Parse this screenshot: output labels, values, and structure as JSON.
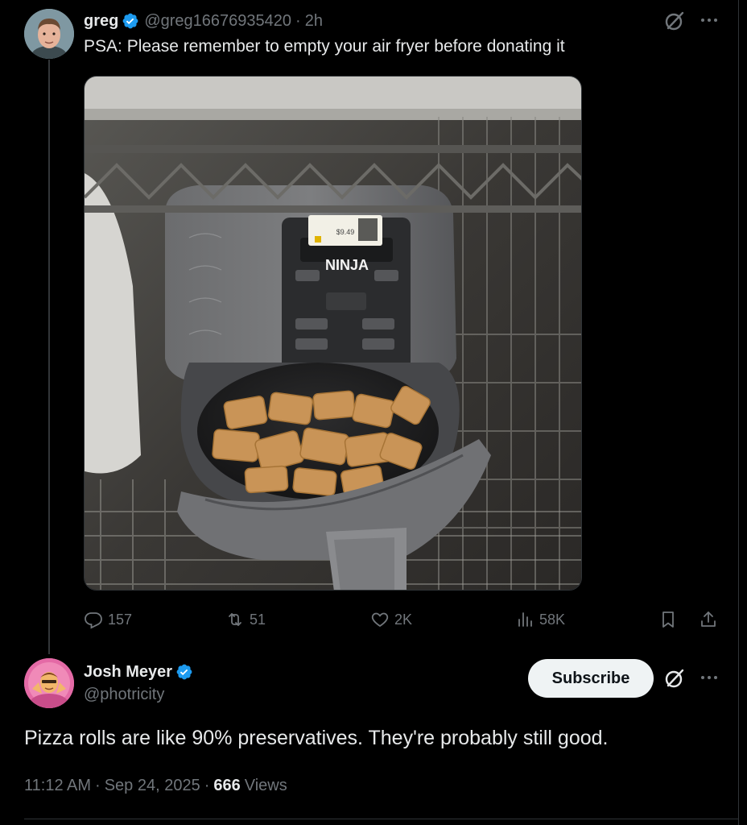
{
  "parent_tweet": {
    "author": {
      "name": "greg",
      "handle": "@greg16676935420",
      "verified": true,
      "avatar": "avatar-photo-greg"
    },
    "time": "2h",
    "text": "PSA: Please remember to empty your air fryer before donating it",
    "media": {
      "description_icon": "photo",
      "brand_label": "NINJA",
      "price_tag": "$9.49"
    },
    "stats": {
      "replies": "157",
      "retweets": "51",
      "likes": "2K",
      "views": "58K"
    }
  },
  "main_tweet": {
    "author": {
      "name": "Josh Meyer",
      "handle": "@photricity",
      "verified": true,
      "avatar": "avatar-photo-josh"
    },
    "subscribe_label": "Subscribe",
    "text": "Pizza rolls are like 90% preservatives. They're probably still good.",
    "timestamp": "11:12 AM",
    "date": "Sep 24, 2025",
    "views_count": "666",
    "views_label": "Views"
  },
  "colors": {
    "background": "#000000",
    "text_primary": "#e7e9ea",
    "text_secondary": "#71767b",
    "verified_blue": "#1d9bf0",
    "divider": "#2f3336"
  },
  "icons": {
    "reply": "reply-bubble-icon",
    "retweet": "retweet-icon",
    "like": "heart-icon",
    "views": "views-bars-icon",
    "bookmark": "bookmark-icon",
    "share": "share-icon",
    "grok": "grok-icon",
    "more": "more-icon",
    "verified": "verified-badge-icon"
  }
}
